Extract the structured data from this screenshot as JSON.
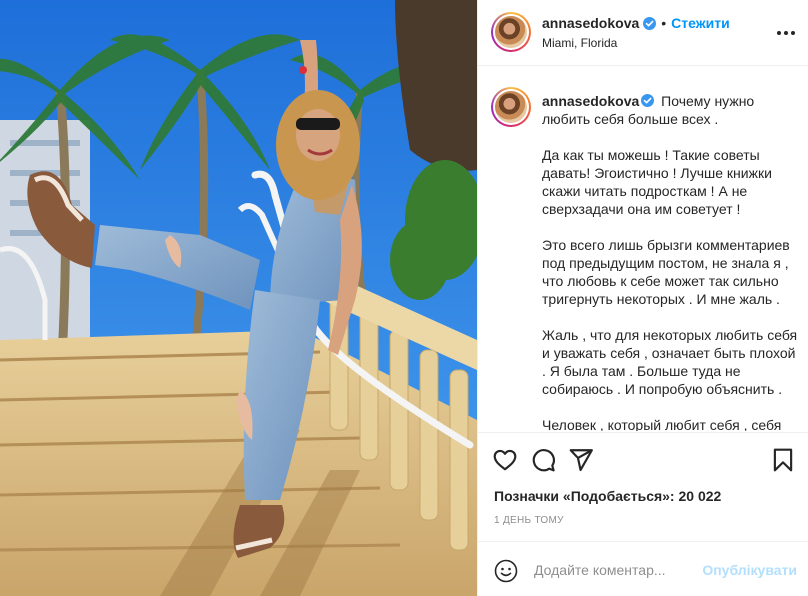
{
  "post": {
    "username": "annasedokova",
    "verified": true,
    "follow_label": "Стежити",
    "separator": "•",
    "location": "Miami, Florida",
    "more_icon": "more-horizontal-icon"
  },
  "caption": {
    "username": "annasedokova",
    "paragraphs": [
      "Почему нужно любить себя больше всех .",
      "Да как ты можешь ! Такие советы давать! Эгоистично ! Лучше книжки скажи читать подросткам ! А не сверхзадачи она им советует !",
      "Это всего лишь брызги комментариев под предыдущим постом, не знала я , что любовь к себе может так сильно тригернуть некоторых . И мне жаль .",
      "Жаль , что для некоторых любить себя и уважать себя , означает быть плохой . Я была там . Больше туда не собираюсь . И попробую объяснить .",
      "Человек , который любит себя , себя"
    ]
  },
  "actions": {
    "like_icon": "heart-icon",
    "comment_icon": "comment-icon",
    "share_icon": "share-icon",
    "save_icon": "bookmark-icon"
  },
  "likes": {
    "label": "Позначки «Подобається»:",
    "count": "20 022"
  },
  "timestamp": "1 день тому",
  "comment": {
    "placeholder": "Додайте коментар...",
    "publish_label": "Опублікувати"
  },
  "colors": {
    "accent": "#0095f6",
    "publish_disabled": "#b2dffc",
    "verified": "#3897f0",
    "text": "#262626",
    "muted": "#8e8e8e"
  }
}
